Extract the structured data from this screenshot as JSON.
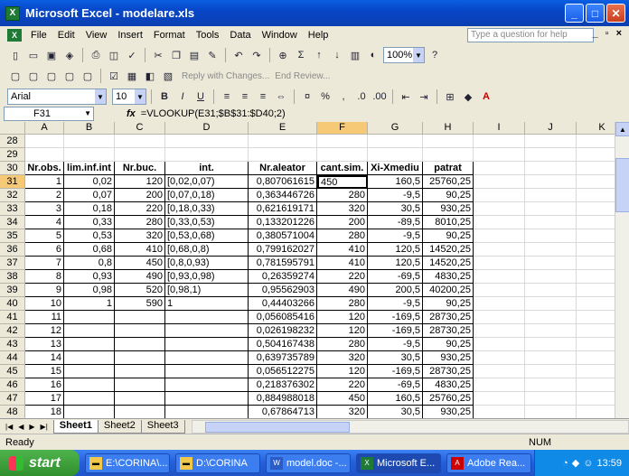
{
  "window": {
    "title": "Microsoft Excel - modelare.xls"
  },
  "menu": {
    "items": [
      "File",
      "Edit",
      "View",
      "Insert",
      "Format",
      "Tools",
      "Data",
      "Window",
      "Help"
    ],
    "ask_placeholder": "Type a question for help"
  },
  "toolbar": {
    "zoom": "100%",
    "font": "Arial",
    "size": "10",
    "reply": "Reply with Changes...",
    "end_review": "End Review..."
  },
  "formula_bar": {
    "cell": "F31",
    "fx": "fx",
    "formula": "=VLOOKUP(E31;$B$31:$D40;2)"
  },
  "columns": [
    "A",
    "B",
    "C",
    "D",
    "E",
    "F",
    "G",
    "H",
    "I",
    "J",
    "K"
  ],
  "rows": [
    {
      "n": "28",
      "cells": [
        "",
        "",
        "",
        "",
        "",
        "",
        "",
        "",
        "",
        "",
        ""
      ]
    },
    {
      "n": "29",
      "cells": [
        "",
        "",
        "",
        "",
        "",
        "",
        "",
        "",
        "",
        "",
        ""
      ]
    },
    {
      "n": "30",
      "cells": [
        "Nr.obs.",
        "lim.inf.int",
        "Nr.buc.",
        "int.",
        "Nr.aleator",
        "cant.sim.",
        "Xi-Xmediu",
        "patrat",
        "",
        "",
        ""
      ]
    },
    {
      "n": "31",
      "cells": [
        "1",
        "0,02",
        "120",
        "[0,02,0,07)",
        "0,807061615",
        "450",
        "160,5",
        "25760,25",
        "",
        "",
        ""
      ]
    },
    {
      "n": "32",
      "cells": [
        "2",
        "0,07",
        "200",
        "[0,07,0,18)",
        "0,363446726",
        "280",
        "-9,5",
        "90,25",
        "",
        "",
        ""
      ]
    },
    {
      "n": "33",
      "cells": [
        "3",
        "0,18",
        "220",
        "[0,18,0,33)",
        "0,621619171",
        "320",
        "30,5",
        "930,25",
        "",
        "",
        ""
      ]
    },
    {
      "n": "34",
      "cells": [
        "4",
        "0,33",
        "280",
        "[0,33,0,53)",
        "0,133201226",
        "200",
        "-89,5",
        "8010,25",
        "",
        "",
        ""
      ]
    },
    {
      "n": "35",
      "cells": [
        "5",
        "0,53",
        "320",
        "[0,53,0,68)",
        "0,380571004",
        "280",
        "-9,5",
        "90,25",
        "",
        "",
        ""
      ]
    },
    {
      "n": "36",
      "cells": [
        "6",
        "0,68",
        "410",
        "[0,68,0,8)",
        "0,799162027",
        "410",
        "120,5",
        "14520,25",
        "",
        "",
        ""
      ]
    },
    {
      "n": "37",
      "cells": [
        "7",
        "0,8",
        "450",
        "[0,8,0,93)",
        "0,781595791",
        "410",
        "120,5",
        "14520,25",
        "",
        "",
        ""
      ]
    },
    {
      "n": "38",
      "cells": [
        "8",
        "0,93",
        "490",
        "[0,93,0,98)",
        "0,26359274",
        "220",
        "-69,5",
        "4830,25",
        "",
        "",
        ""
      ]
    },
    {
      "n": "39",
      "cells": [
        "9",
        "0,98",
        "520",
        "[0,98,1)",
        "0,95562903",
        "490",
        "200,5",
        "40200,25",
        "",
        "",
        ""
      ]
    },
    {
      "n": "40",
      "cells": [
        "10",
        "1",
        "590",
        "1",
        "0,44403266",
        "280",
        "-9,5",
        "90,25",
        "",
        "",
        ""
      ]
    },
    {
      "n": "41",
      "cells": [
        "11",
        "",
        "",
        "",
        "0,056085416",
        "120",
        "-169,5",
        "28730,25",
        "",
        "",
        ""
      ]
    },
    {
      "n": "42",
      "cells": [
        "12",
        "",
        "",
        "",
        "0,026198232",
        "120",
        "-169,5",
        "28730,25",
        "",
        "",
        ""
      ]
    },
    {
      "n": "43",
      "cells": [
        "13",
        "",
        "",
        "",
        "0,504167438",
        "280",
        "-9,5",
        "90,25",
        "",
        "",
        ""
      ]
    },
    {
      "n": "44",
      "cells": [
        "14",
        "",
        "",
        "",
        "0,639735789",
        "320",
        "30,5",
        "930,25",
        "",
        "",
        ""
      ]
    },
    {
      "n": "45",
      "cells": [
        "15",
        "",
        "",
        "",
        "0,056512275",
        "120",
        "-169,5",
        "28730,25",
        "",
        "",
        ""
      ]
    },
    {
      "n": "46",
      "cells": [
        "16",
        "",
        "",
        "",
        "0,218376302",
        "220",
        "-69,5",
        "4830,25",
        "",
        "",
        ""
      ]
    },
    {
      "n": "47",
      "cells": [
        "17",
        "",
        "",
        "",
        "0,884988018",
        "450",
        "160,5",
        "25760,25",
        "",
        "",
        ""
      ]
    },
    {
      "n": "48",
      "cells": [
        "18",
        "",
        "",
        "",
        "0,67864713",
        "320",
        "30,5",
        "930,25",
        "",
        "",
        ""
      ]
    }
  ],
  "sheets": [
    "Sheet1",
    "Sheet2",
    "Sheet3"
  ],
  "status": {
    "ready": "Ready",
    "num": "NUM"
  },
  "taskbar": {
    "start": "start",
    "tasks": [
      "E:\\CORINA\\...",
      "D:\\CORINA",
      "model.doc -...",
      "Microsoft E...",
      "Adobe Rea..."
    ],
    "clock": "13:59"
  }
}
